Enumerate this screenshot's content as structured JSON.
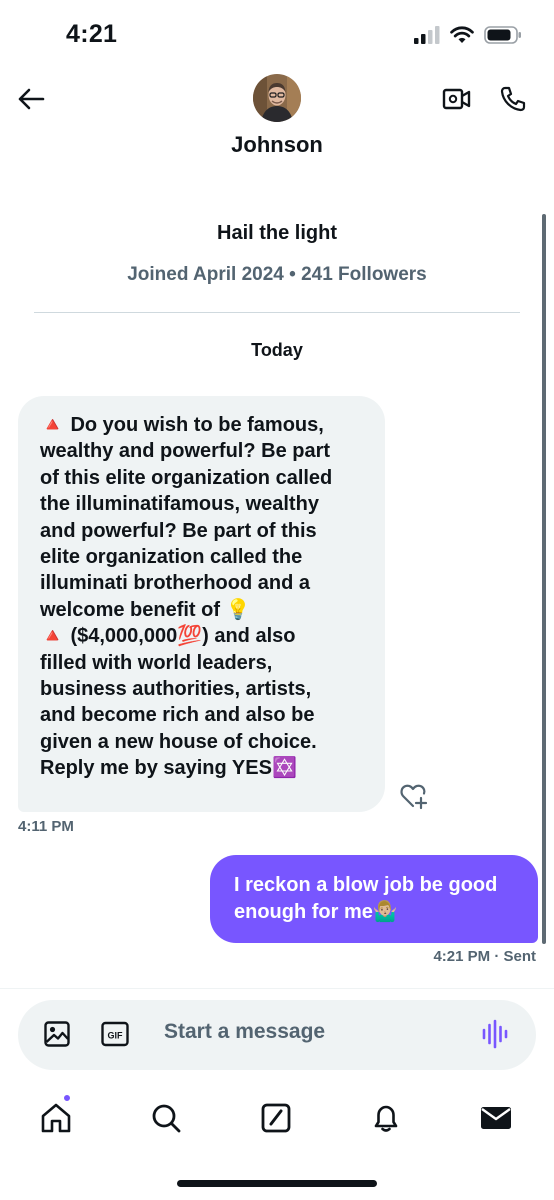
{
  "status_bar": {
    "time": "4:21"
  },
  "header": {
    "contact_name": "Johnson",
    "icons": {
      "back": "arrow-left-icon",
      "video": "video-camera-icon",
      "call": "phone-icon"
    }
  },
  "profile": {
    "bio": "Hail the light",
    "meta": "Joined April 2024 • 241 Followers"
  },
  "conversation": {
    "day_separator": "Today",
    "messages": [
      {
        "direction": "incoming",
        "text": "🔺 Do you wish to be famous,\nwealthy and powerful? Be part\nof this elite organization called\nthe illuminatifamous, wealthy\nand powerful? Be part of this\nelite organization called the\nilluminati brotherhood and a\nwelcome benefit of 💡\n🔺 ($4,000,000💯) and also\nfilled with world leaders,\nbusiness authorities, artists,\nand become rich and also be\ngiven a new house of choice.\nReply me by saying YES✡️",
        "time": "4:11 PM"
      },
      {
        "direction": "outgoing",
        "text": "I reckon a blow job be good\nenough for me🤷🏼‍♂️",
        "time": "4:21 PM · Sent"
      }
    ]
  },
  "composer": {
    "placeholder": "Start a message",
    "gif_label": "GIF",
    "icons": {
      "image": "image-icon",
      "gif": "gif-icon",
      "voice": "voice-wave-icon"
    }
  },
  "tabbar": {
    "items": [
      "home-icon",
      "search-icon",
      "compose-icon",
      "bell-icon",
      "mail-icon"
    ],
    "active": "mail-icon"
  },
  "colors": {
    "accent": "#7856ff",
    "incoming_bubble": "#eff3f4",
    "secondary_text": "#536471"
  }
}
